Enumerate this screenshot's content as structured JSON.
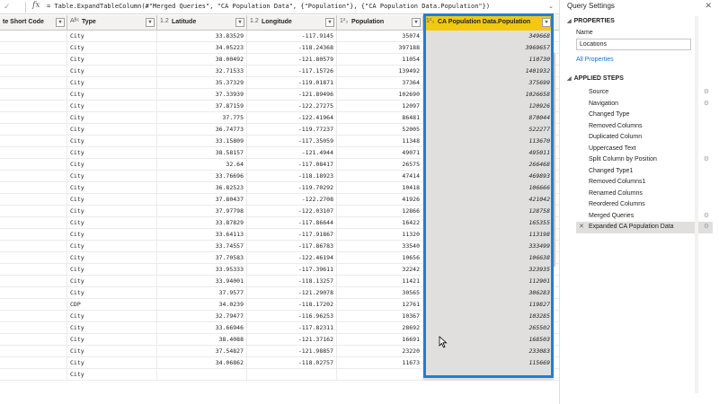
{
  "formula_bar": {
    "check_icon": "checkmark-icon",
    "fx_label": "fx",
    "formula": "= Table.ExpandTableColumn(#\"Merged Queries\", \"CA Population Data\", {\"Population\"}, {\"CA Population Data.Population\"})",
    "expand_icon": "chevron-down-icon"
  },
  "grid": {
    "columns": [
      {
        "type_icon": "",
        "label": "te Short Code"
      },
      {
        "type_icon": "Aᴮᶜ",
        "label": "Type"
      },
      {
        "type_icon": "1.2",
        "label": "Latitude"
      },
      {
        "type_icon": "1.2",
        "label": "Longitude"
      },
      {
        "type_icon": "1²₃",
        "label": "Population"
      },
      {
        "type_icon": "1²₃",
        "label": "CA Population Data.Population"
      }
    ],
    "rows": [
      [
        "",
        "City",
        "33.83529",
        "-117.9145",
        "35074",
        "349668"
      ],
      [
        "",
        "City",
        "34.05223",
        "-118.24368",
        "397188",
        "3969657"
      ],
      [
        "",
        "City",
        "38.00492",
        "-121.80579",
        "11054",
        "110730"
      ],
      [
        "",
        "City",
        "32.71533",
        "-117.15726",
        "139492",
        "1401932"
      ],
      [
        "",
        "City",
        "35.37329",
        "-119.01871",
        "37364",
        "375699"
      ],
      [
        "",
        "City",
        "37.33939",
        "-121.89496",
        "102690",
        "1026658"
      ],
      [
        "",
        "City",
        "37.87159",
        "-122.27275",
        "12097",
        "120926"
      ],
      [
        "",
        "City",
        "37.775",
        "-122.41964",
        "86481",
        "870044"
      ],
      [
        "",
        "City",
        "36.74773",
        "-119.77237",
        "52005",
        "522277"
      ],
      [
        "",
        "City",
        "33.15809",
        "-117.35059",
        "11348",
        "113670"
      ],
      [
        "",
        "City",
        "38.58157",
        "-121.4944",
        "49071",
        "495011"
      ],
      [
        "",
        "City",
        "32.64",
        "-117.08417",
        "26575",
        "266468"
      ],
      [
        "",
        "City",
        "33.76696",
        "-118.18923",
        "47414",
        "469893"
      ],
      [
        "",
        "City",
        "36.82523",
        "-119.70292",
        "10418",
        "106666"
      ],
      [
        "",
        "City",
        "37.80437",
        "-122.2708",
        "41926",
        "421042"
      ],
      [
        "",
        "City",
        "37.97798",
        "-122.03107",
        "12866",
        "128758"
      ],
      [
        "",
        "City",
        "33.87829",
        "-117.86644",
        "16422",
        "165355"
      ],
      [
        "",
        "City",
        "33.64113",
        "-117.91867",
        "11320",
        "113198"
      ],
      [
        "",
        "City",
        "33.74557",
        "-117.86783",
        "33540",
        "333499"
      ],
      [
        "",
        "City",
        "37.70583",
        "-122.46194",
        "10656",
        "106638"
      ],
      [
        "",
        "City",
        "33.95333",
        "-117.39611",
        "32242",
        "323935"
      ],
      [
        "",
        "City",
        "33.94001",
        "-118.13257",
        "11421",
        "112901"
      ],
      [
        "",
        "City",
        "37.9577",
        "-121.29078",
        "30565",
        "306283"
      ],
      [
        "",
        "CDP",
        "34.0239",
        "-118.17202",
        "12761",
        "119827"
      ],
      [
        "",
        "City",
        "32.79477",
        "-116.96253",
        "10367",
        "103285"
      ],
      [
        "",
        "City",
        "33.66946",
        "-117.82311",
        "28692",
        "265502"
      ],
      [
        "",
        "City",
        "38.4088",
        "-121.37162",
        "16691",
        "168503"
      ],
      [
        "",
        "City",
        "37.54827",
        "-121.98857",
        "23220",
        "233083"
      ],
      [
        "",
        "City",
        "34.06862",
        "-118.02757",
        "11673",
        "115669"
      ],
      [
        "",
        "City",
        "",
        "",
        "",
        ""
      ]
    ]
  },
  "panel": {
    "title": "Query Settings",
    "close_icon": "close-icon",
    "properties_heading": "PROPERTIES",
    "name_label": "Name",
    "name_value": "Locations",
    "all_properties_link": "All Properties",
    "applied_steps_heading": "APPLIED STEPS",
    "steps": [
      {
        "label": "Source",
        "gear": true
      },
      {
        "label": "Navigation",
        "gear": true
      },
      {
        "label": "Changed Type",
        "gear": false
      },
      {
        "label": "Removed Columns",
        "gear": false
      },
      {
        "label": "Duplicated Column",
        "gear": false
      },
      {
        "label": "Uppercased Text",
        "gear": false
      },
      {
        "label": "Split Column by Position",
        "gear": true
      },
      {
        "label": "Changed Type1",
        "gear": false
      },
      {
        "label": "Removed Columns1",
        "gear": false
      },
      {
        "label": "Renamed Columns",
        "gear": false
      },
      {
        "label": "Reordered Columns",
        "gear": false
      },
      {
        "label": "Merged Queries",
        "gear": true
      },
      {
        "label": "Expanded CA Population Data",
        "gear": true,
        "selected": true
      }
    ]
  },
  "colors": {
    "highlight_border": "#1f7fd4",
    "selected_header": "#f2c811",
    "link": "#1f6fc5"
  }
}
